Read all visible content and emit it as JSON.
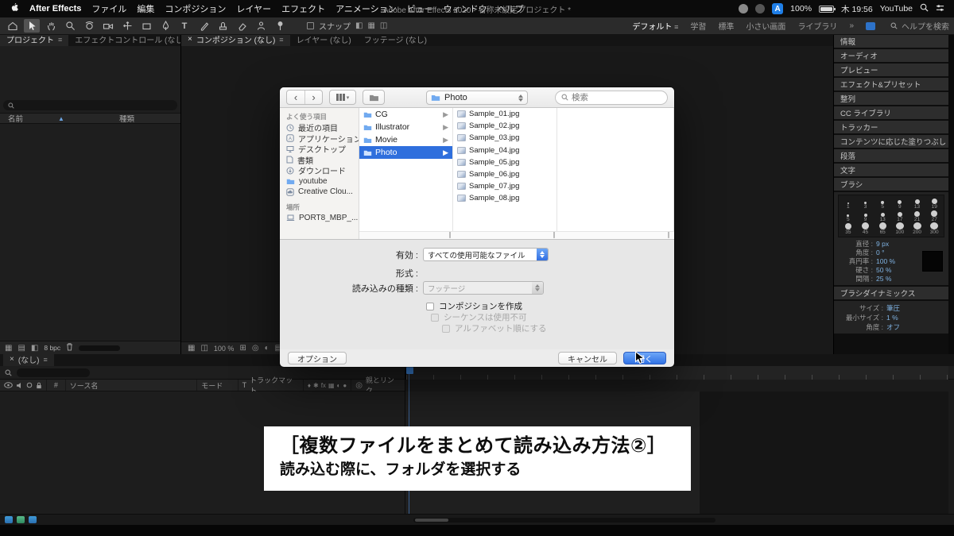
{
  "menubar": {
    "app_name": "After Effects",
    "menus": [
      "ファイル",
      "編集",
      "コンポジション",
      "レイヤー",
      "エフェクト",
      "アニメーション",
      "ビュー",
      "ウィンドウ",
      "ヘルプ"
    ],
    "window_title": "Adobe After Effects 2020 - 名称未設定プロジェクト *",
    "right": {
      "input_badge": "A",
      "battery": "100%",
      "clock": "木 19:56",
      "youtube": "YouTube"
    }
  },
  "toolbar": {
    "snap": "スナップ",
    "workspaces": [
      "デフォルト",
      "学習",
      "標準",
      "小さい画面",
      "ライブラリ"
    ],
    "help_search": "ヘルプを検索"
  },
  "panels": {
    "project_tab": "プロジェクト",
    "effect_controls_tab": "エフェクトコントロール (なし)",
    "name_col": "名前",
    "kind_col": "種類",
    "bpc": "8 bpc",
    "comp_tab": "コンポジション (なし)",
    "layer_tab": "レイヤー (なし)",
    "footage_tab": "フッテージ (なし)",
    "zoom": "100 %"
  },
  "right_sidebar": {
    "items": [
      "情報",
      "オーディオ",
      "プレビュー",
      "エフェクト&プリセット",
      "整列",
      "CC ライブラリ",
      "トラッカー",
      "コンテンツに応じた塗りつぶし",
      "段落",
      "文字"
    ],
    "brush": {
      "title": "ブラシ",
      "grid": [
        [
          "1",
          "3",
          "5",
          "9",
          "13",
          "19"
        ],
        [
          "5",
          "9",
          "13",
          "17",
          "21",
          "27"
        ],
        [
          "35",
          "45",
          "65",
          "100",
          "200",
          "300"
        ]
      ],
      "settings": [
        {
          "label": "直径 :",
          "value": "9 px"
        },
        {
          "label": "角度 :",
          "value": "0 °"
        },
        {
          "label": "真円率 :",
          "value": "100 %"
        },
        {
          "label": "硬さ :",
          "value": "50 %"
        },
        {
          "label": "間隔 :",
          "value": "25 %"
        }
      ],
      "dynamics_title": "ブラシダイナミックス",
      "dynamics": [
        {
          "label": "サイズ :",
          "value": "筆圧"
        },
        {
          "label": "最小サイズ :",
          "value": "1 %"
        },
        {
          "label": "角度 :",
          "value": "オフ"
        }
      ]
    }
  },
  "dialog": {
    "folder_popup": "Photo",
    "search_placeholder": "検索",
    "sidebar": {
      "favorites_title": "よく使う項目",
      "favorites": [
        "最近の項目",
        "アプリケーション",
        "デスクトップ",
        "書類",
        "ダウンロード",
        "youtube",
        "Creative Clou..."
      ],
      "locations_title": "場所",
      "locations": [
        "PORT8_MBP_..."
      ]
    },
    "folders": [
      "CG",
      "Illustrator",
      "Movie",
      "Photo"
    ],
    "files": [
      "Sample_01.jpg",
      "Sample_02.jpg",
      "Sample_03.jpg",
      "Sample_04.jpg",
      "Sample_05.jpg",
      "Sample_06.jpg",
      "Sample_07.jpg",
      "Sample_08.jpg"
    ],
    "form": {
      "enable_label": "有効 :",
      "enable_value": "すべての使用可能なファイル",
      "format_label": "形式 :",
      "kind_label": "読み込みの種類 :",
      "kind_value": "フッテージ",
      "cb_create_comp": "コンポジションを作成",
      "cb_sequence": "シーケンスは使用不可",
      "cb_alphabetical": "アルファベット順にする"
    },
    "buttons": {
      "options": "オプション",
      "cancel": "キャンセル",
      "open": "開く"
    }
  },
  "timeline": {
    "tab": "(なし)",
    "hash": "#",
    "source_name": "ソース名",
    "mode": "モード",
    "t_label": "T",
    "trkmat": "トラックマット",
    "parent": "親とリンク"
  },
  "caption": {
    "line1": "［複数ファイルをまとめて読み込み方法②］",
    "line2": "読み込む際に、フォルダを選択する"
  }
}
